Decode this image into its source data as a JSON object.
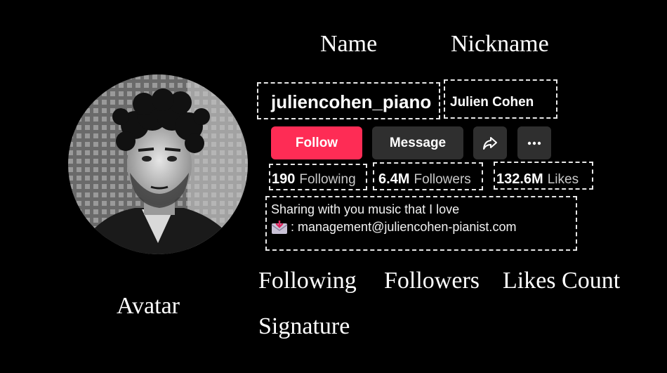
{
  "annotation_labels": {
    "name": "Name",
    "nickname": "Nickname",
    "avatar": "Avatar",
    "following": "Following",
    "followers": "Followers",
    "likes_count": "Likes Count",
    "signature": "Signature"
  },
  "profile": {
    "username": "juliencohen_piano",
    "nickname": "Julien Cohen",
    "avatar_alt": "profile photo"
  },
  "actions": {
    "follow": "Follow",
    "message": "Message",
    "share_icon": "share-icon",
    "more_icon": "more-icon"
  },
  "stats": {
    "following_count": "190",
    "following_label": "Following",
    "followers_count": "6.4M",
    "followers_label": "Followers",
    "likes_count": "132.6M",
    "likes_label": "Likes"
  },
  "bio": {
    "line1": "Sharing with you music that I love",
    "line2": ": management@juliencohen-pianist.com",
    "email_icon": "envelope-icon"
  },
  "colors": {
    "background": "#000000",
    "follow_button": "#fe2c55",
    "secondary_button": "#2f2f2f"
  }
}
